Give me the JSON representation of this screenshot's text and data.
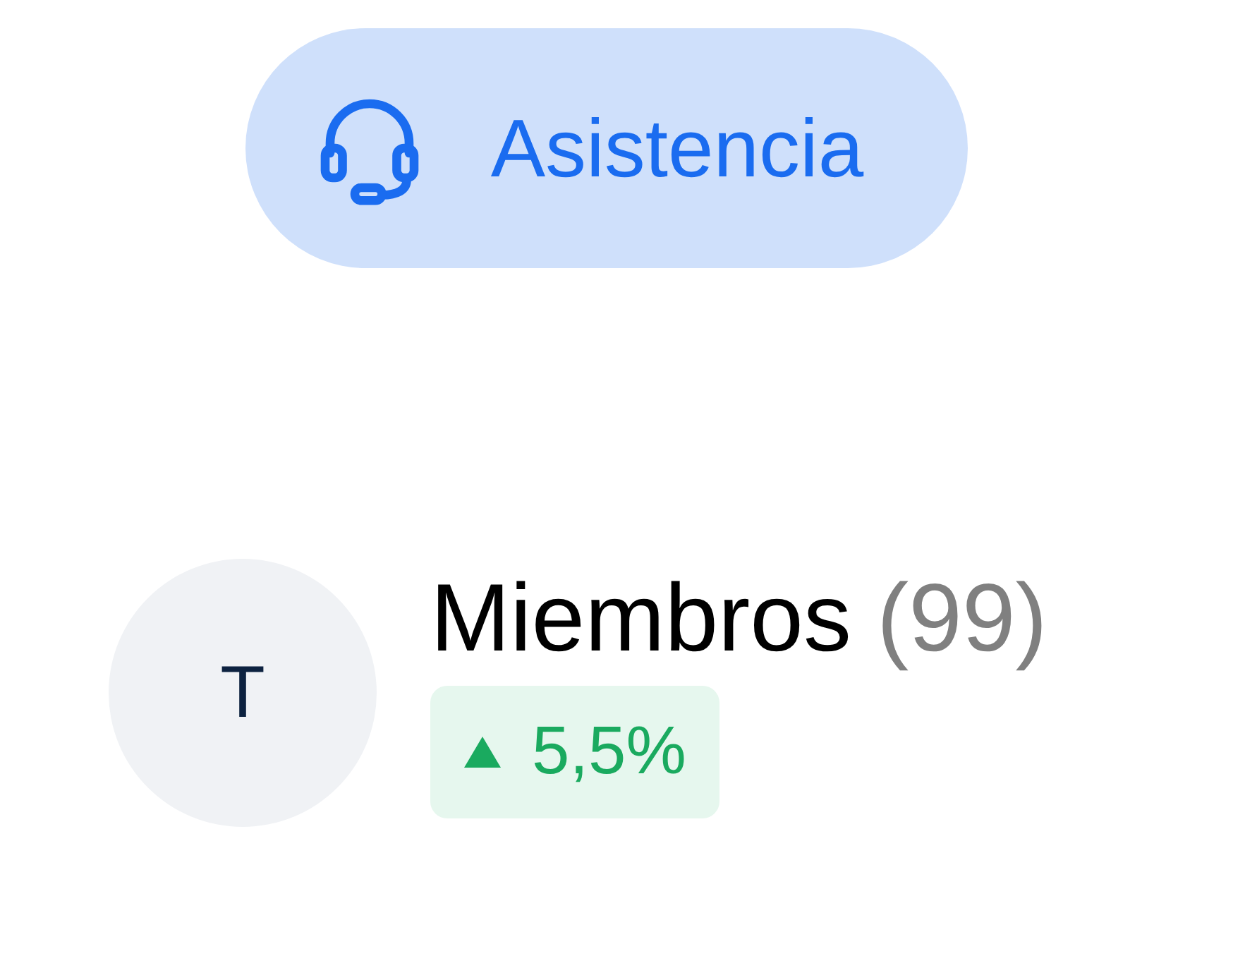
{
  "support_button": {
    "label": "Asistencia"
  },
  "member_card": {
    "avatar_initial": "T",
    "title": "Miembros",
    "count": "(99)",
    "change": {
      "positive": true,
      "value": "5,5%"
    }
  }
}
